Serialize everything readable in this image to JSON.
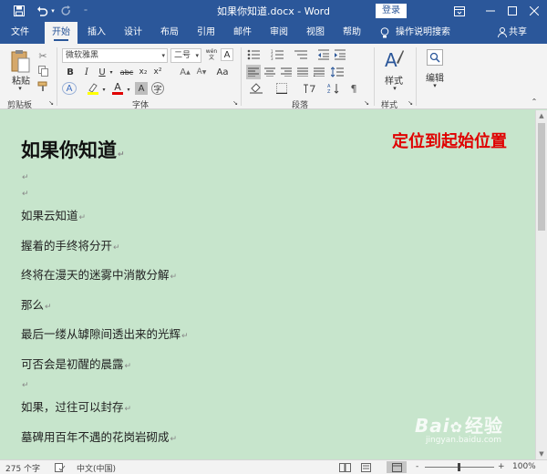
{
  "titlebar": {
    "title": "如果你知道.docx - Word",
    "login": "登录",
    "icons": [
      "save-icon",
      "undo-icon",
      "redo-icon",
      "customize-icon",
      "ribbon-display-icon",
      "minimize-icon",
      "maximize-icon",
      "close-icon"
    ]
  },
  "tabs": [
    "文件",
    "开始",
    "插入",
    "设计",
    "布局",
    "引用",
    "邮件",
    "审阅",
    "视图",
    "帮助"
  ],
  "tell_me": "操作说明搜索",
  "share": "共享",
  "ribbon": {
    "clipboard": {
      "paste": "粘贴",
      "label": "剪贴板"
    },
    "font": {
      "name": "微软雅黑",
      "size": "二号",
      "wen": "wén",
      "label": "字体",
      "bold": "B",
      "italic": "I",
      "underline": "U",
      "strike": "abc",
      "sub": "x₂",
      "sup": "x²",
      "clear": "A",
      "font_color": "A",
      "shade": "A",
      "enclose": "字"
    },
    "paragraph": {
      "label": "段落"
    },
    "styles": {
      "button": "样式",
      "label": "样式"
    },
    "editing": {
      "button": "编辑"
    }
  },
  "document": {
    "title": "如果你知道",
    "lines": [
      "",
      "",
      "如果云知道",
      "握着的手终将分开",
      "终将在漫天的迷雾中消散分解",
      "那么",
      "最后一缕从罅隙间透出来的光辉",
      "可否会是初醒的晨露",
      "",
      "如果，过往可以封存",
      "墓碑用百年不遇的花岗岩砌成"
    ],
    "para_mark": "↵",
    "note": "定位到起始位置"
  },
  "watermark": {
    "main": "Bai",
    "cn": "经验",
    "sub": "jingyan.baidu.com"
  },
  "status": {
    "words": "275 个字",
    "lang": "中文(中国)",
    "zoom": "100%",
    "minus": "-",
    "plus": "+"
  },
  "colors": {
    "accent": "#2b579a",
    "doc_bg": "#c7e5cc",
    "note": "#e00000"
  }
}
